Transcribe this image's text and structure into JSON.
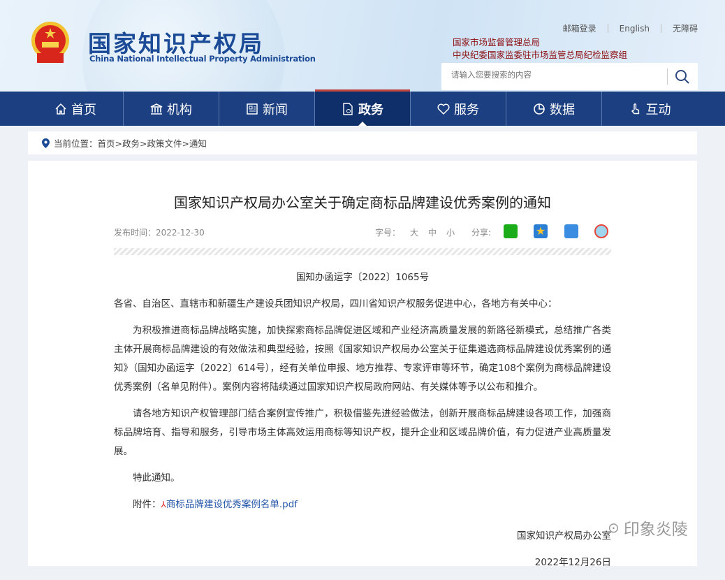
{
  "header": {
    "logo_cn": "国家知识产权局",
    "logo_en": "China National Intellectual Property Administration",
    "top_links": [
      "邮箱登录",
      "English",
      "无障碍"
    ],
    "orgs": [
      "国家市场监督管理总局",
      "中央纪委国家监委驻市场监管总局纪检监察组"
    ],
    "search_placeholder": "请输入您要搜索的内容"
  },
  "nav": [
    {
      "label": "首页",
      "icon": "home-icon"
    },
    {
      "label": "机构",
      "icon": "institution-icon"
    },
    {
      "label": "新闻",
      "icon": "news-icon"
    },
    {
      "label": "政务",
      "icon": "document-icon",
      "active": true
    },
    {
      "label": "服务",
      "icon": "heart-icon"
    },
    {
      "label": "数据",
      "icon": "pie-chart-icon"
    },
    {
      "label": "互动",
      "icon": "hand-icon"
    }
  ],
  "breadcrumb": {
    "label": "当前位置：",
    "path": "首页>政务>政策文件>通知"
  },
  "article": {
    "title": "国家知识产权局办公室关于确定商标品牌建设优秀案例的通知",
    "publish": "发布时间：2022-12-30",
    "font_label": "字号：",
    "font_sizes": [
      "大",
      "中",
      "小"
    ],
    "share_label": "分享:",
    "doc_no": "国知办函运字〔2022〕1065号",
    "recipients": "各省、自治区、直辖市和新疆生产建设兵团知识产权局，四川省知识产权服务促进中心，各地方有关中心：",
    "para1": "为积极推进商标品牌战略实施，加快探索商标品牌促进区域和产业经济高质量发展的新路径新模式，总结推广各类主体开展商标品牌建设的有效做法和典型经验，按照《国家知识产权局办公室关于征集遴选商标品牌建设优秀案例的通知》（国知办函运字〔2022〕614号），经有关单位申报、地方推荐、专家评审等环节，确定108个案例为商标品牌建设优秀案例（名单见附件）。案例内容将陆续通过国家知识产权局政府网站、有关媒体等予以公布和推介。",
    "para2": "请各地方知识产权管理部门结合案例宣传推广，积极借鉴先进经验做法，创新开展商标品牌建设各项工作，加强商标品牌培育、指导和服务，引导市场主体高效运用商标等知识产权，提升企业和区域品牌价值，有力促进产业高质量发展。",
    "closing": "特此通知。",
    "attach_label": "附件：",
    "attach_file": "商标品牌建设优秀案例名单.pdf",
    "signer": "国家知识产权局办公室",
    "date": "2022年12月26日"
  },
  "watermark": "印象炎陵",
  "colors": {
    "nav": "#1b3f81",
    "nav_active": "#0f2f6b",
    "brand": "#1b4b97",
    "org": "#8b0d10"
  }
}
